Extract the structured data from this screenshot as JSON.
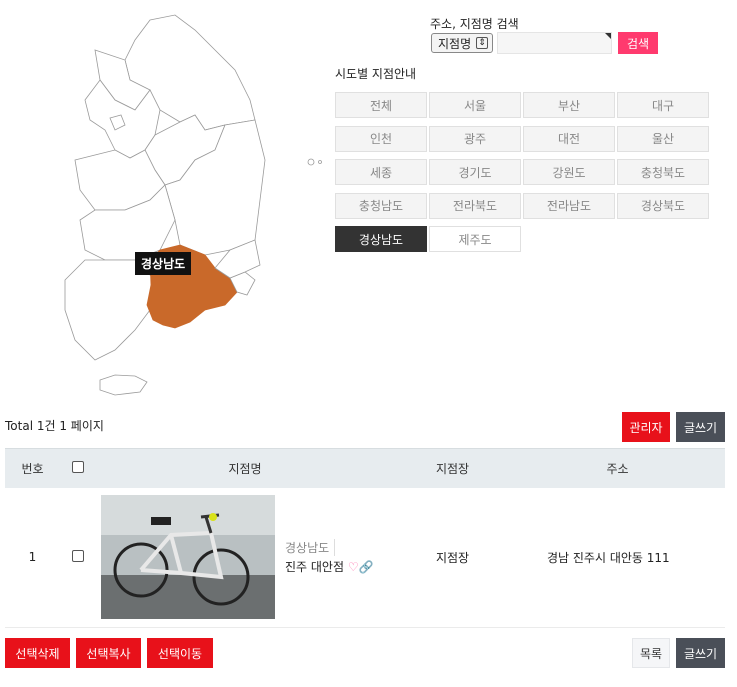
{
  "map": {
    "selected_region_label": "경상남도"
  },
  "search": {
    "label": "주소, 지점명 검색",
    "select_value": "지점명",
    "input_value": "",
    "button": "검색"
  },
  "region_section": {
    "title": "시도별 지점안내",
    "regions": [
      "전체",
      "서울",
      "부산",
      "대구",
      "인천",
      "광주",
      "대전",
      "울산",
      "세종",
      "경기도",
      "강원도",
      "충청북도",
      "충청남도",
      "전라북도",
      "전라남도",
      "경상북도",
      "경상남도",
      "제주도"
    ],
    "active_region": "경상남도"
  },
  "board": {
    "total": "Total 1건 1 페이지",
    "admin_button": "관리자",
    "write_button": "글쓰기",
    "columns": [
      "번호",
      "",
      "지점명",
      "지점장",
      "주소"
    ],
    "rows": [
      {
        "no": "1",
        "category": "경상남도",
        "name": "진주 대안점",
        "manager": "지점장",
        "address": "경남 진주시 대안동 111"
      }
    ],
    "actions": {
      "delete": "선택삭제",
      "copy": "선택복사",
      "move": "선택이동",
      "list": "목록",
      "write": "글쓰기"
    }
  },
  "colors": {
    "active_region_fill": "#c9692a",
    "search_button": "#ff3a6e",
    "action_red": "#e8111a",
    "action_dark": "#4a4f58"
  }
}
